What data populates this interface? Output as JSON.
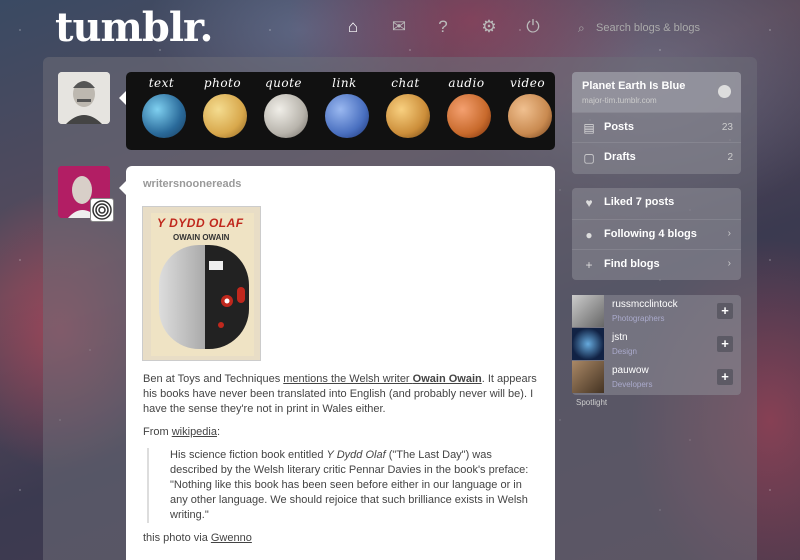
{
  "header": {
    "logo": "tumblr.",
    "search_placeholder": "Search blogs & blogs"
  },
  "postbar": [
    {
      "label": "text",
      "color": "#3a7fb0"
    },
    {
      "label": "photo",
      "color": "#d8a84c"
    },
    {
      "label": "quote",
      "color": "#c4c0b8"
    },
    {
      "label": "link",
      "color": "#4a70c0"
    },
    {
      "label": "chat",
      "color": "#cc8e3a"
    },
    {
      "label": "audio",
      "color": "#c86a2c"
    },
    {
      "label": "video",
      "color": "#c98a50"
    }
  ],
  "post": {
    "username": "writersnoonereads",
    "cover": {
      "title": "Y DYDD OLAF",
      "author": "OWAIN OWAIN"
    },
    "para1_start": "Ben at Toys and Techniques ",
    "para1_link": "mentions the Welsh writer ",
    "para1_link_bold": "Owain Owain",
    "para1_end": ". It appears his books have never been translated into English (and probably never will be). I have the sense they're not in print in Wales either.",
    "from_label": "From ",
    "from_link": "wikipedia",
    "from_colon": ":",
    "quote_1": "His science fiction book entitled ",
    "quote_title": "Y Dydd Olaf",
    "quote_2": " (\"The Last Day\") was described by the Welsh literary critic Pennar Davies in the book's preface: \"Nothing like this book has been seen before either in our language or in any other language. We should rejoice that such brilliance exists in Welsh writing.\"",
    "via_label": "this photo via ",
    "via_link": "Gwenno"
  },
  "sidebar": {
    "blog_name": "Planet Earth Is Blue",
    "blog_url": "major-tim.tumblr.com",
    "posts_label": "Posts",
    "posts_count": "23",
    "drafts_label": "Drafts",
    "drafts_count": "2",
    "liked_label": "Liked 7 posts",
    "following_label": "Following 4 blogs",
    "find_label": "Find blogs",
    "spotlight": [
      {
        "name": "russmcclintock",
        "category": "Photographers"
      },
      {
        "name": "jstn",
        "category": "Design"
      },
      {
        "name": "pauwow",
        "category": "Developers"
      }
    ],
    "spotlight_label": "Spotlight"
  }
}
